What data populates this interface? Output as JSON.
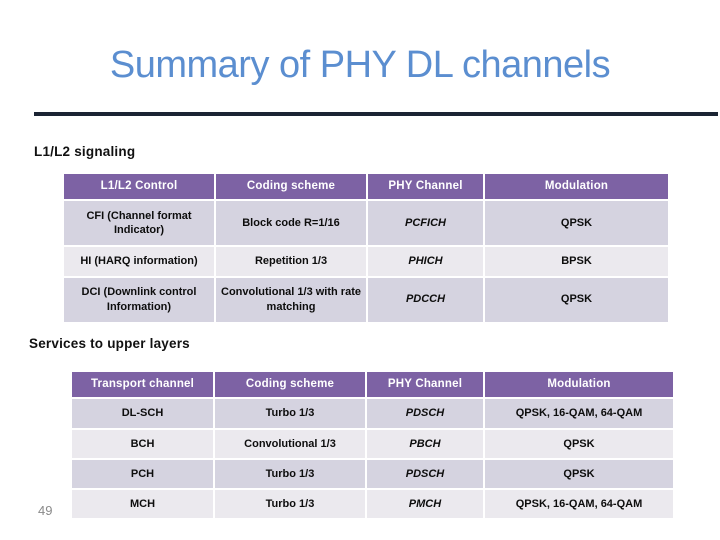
{
  "slide": {
    "title": "Summary of PHY DL channels",
    "page_number": "49",
    "title_color": "#5b8ed0",
    "rule_color": "#1b2433",
    "header_color": "#7d62a4",
    "row_dark_color": "#d5d3e0",
    "row_light_color": "#ebe9ee"
  },
  "section_one": {
    "label": "L1/L2 signaling",
    "table": {
      "headers": [
        "L1/L2 Control",
        "Coding scheme",
        "PHY Channel",
        "Modulation"
      ],
      "rows": [
        {
          "control": "CFI (Channel format Indicator)",
          "coding": "Block code R=1/16",
          "phy": "PCFICH",
          "modulation": "QPSK"
        },
        {
          "control": "HI (HARQ information)",
          "coding": "Repetition 1/3",
          "phy": "PHICH",
          "modulation": "BPSK"
        },
        {
          "control": "DCI (Downlink control Information)",
          "coding": "Convolutional 1/3 with rate matching",
          "phy": "PDCCH",
          "modulation": "QPSK"
        }
      ]
    }
  },
  "section_two": {
    "label": "Services to upper layers",
    "table": {
      "headers": [
        "Transport channel",
        "Coding scheme",
        "PHY Channel",
        "Modulation"
      ],
      "rows": [
        {
          "channel": "DL-SCH",
          "coding": "Turbo 1/3",
          "phy": "PDSCH",
          "modulation": "QPSK, 16-QAM, 64-QAM"
        },
        {
          "channel": "BCH",
          "coding": "Convolutional 1/3",
          "phy": "PBCH",
          "modulation": "QPSK"
        },
        {
          "channel": "PCH",
          "coding": "Turbo 1/3",
          "phy": "PDSCH",
          "modulation": "QPSK"
        },
        {
          "channel": "MCH",
          "coding": "Turbo 1/3",
          "phy": "PMCH",
          "modulation": "QPSK, 16-QAM, 64-QAM"
        }
      ]
    }
  }
}
